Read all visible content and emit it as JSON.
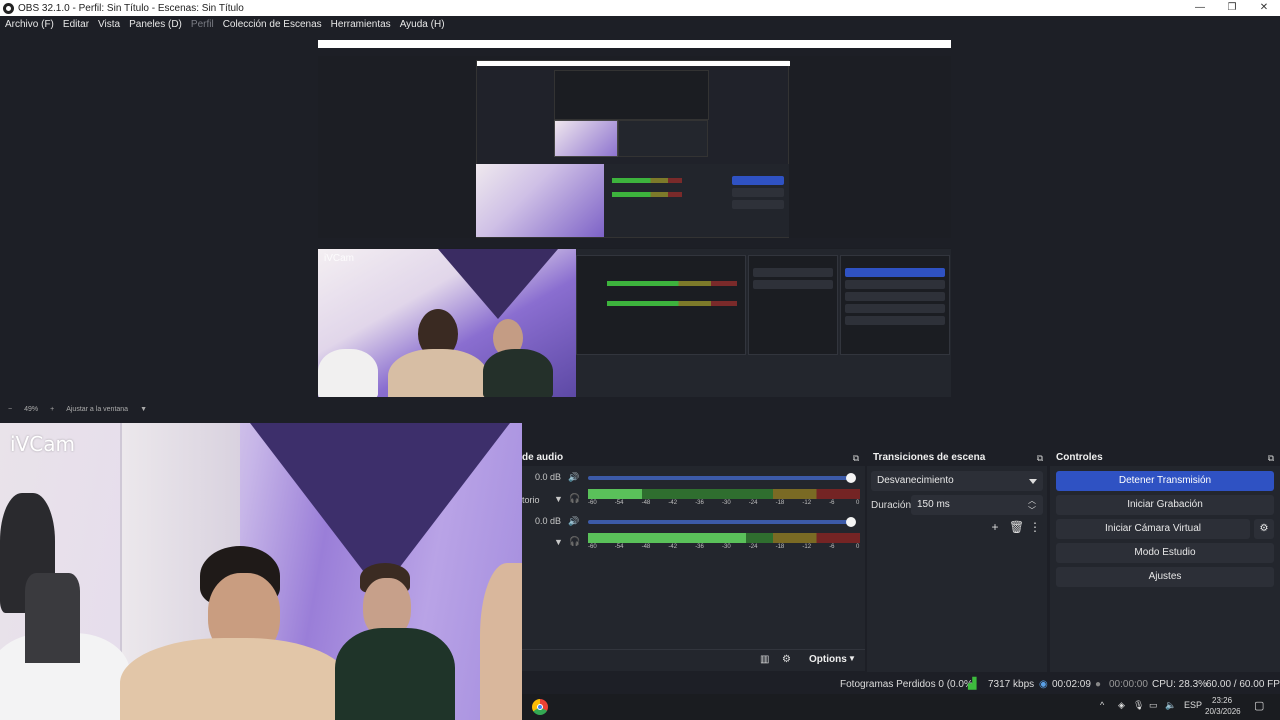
{
  "window": {
    "title": "OBS 32.1.0 - Perfil: Sin Título - Escenas: Sin Título",
    "minimize": "—",
    "maximize": "❐",
    "close": "✕"
  },
  "menu": [
    {
      "label": "Archivo (F)",
      "disabled": false
    },
    {
      "label": "Editar",
      "disabled": false
    },
    {
      "label": "Vista",
      "disabled": false
    },
    {
      "label": "Paneles (D)",
      "disabled": false
    },
    {
      "label": "Perfil",
      "disabled": true
    },
    {
      "label": "Colección de Escenas",
      "disabled": false
    },
    {
      "label": "Herramientas",
      "disabled": false
    },
    {
      "label": "Ayuda (H)",
      "disabled": false
    }
  ],
  "preview": {
    "source_label": "iVCam",
    "inner_source_label": "iVCam"
  },
  "zoombar": {
    "minus": "−",
    "zoom": "49%",
    "plus": "+",
    "fit": "Ajustar a la ventana"
  },
  "camera": {
    "label": "iVCam"
  },
  "mixer": {
    "title": "de audio",
    "tracks": [
      {
        "name": "torio",
        "db": "0.0 dB",
        "level": 0.2
      },
      {
        "name": "",
        "db": "0.0 dB",
        "level": 0.58
      }
    ],
    "scale": [
      "-60",
      "-54",
      "-48",
      "-42",
      "-36",
      "-30",
      "-24",
      "-18",
      "-12",
      "-6",
      "0"
    ],
    "footer_options": "Options"
  },
  "transitions": {
    "title": "Transiciones de escena",
    "type": "Desvanecimiento",
    "duration_label": "Duración",
    "duration_value": "150 ms"
  },
  "controls": {
    "title": "Controles",
    "buttons": [
      "Detener Transmisión",
      "Iniciar Grabación",
      "Iniciar Cámara Virtual",
      "Modo Estudio",
      "Ajustes"
    ]
  },
  "status": {
    "dropped": "Fotogramas Perdidos 0 (0.0%)",
    "bitrate": "7317 kbps",
    "stream_time": "00:02:09",
    "record_time": "00:00:00",
    "cpu": "CPU: 28.3%",
    "fps": "60.00 / 60.00 FPS"
  },
  "taskbar": {
    "lang": "ESP",
    "time": "23:26",
    "date": "20/3/2026"
  },
  "colors": {
    "accent": "#2f52c3",
    "meter_green": "#5ac15a",
    "bitrate_green": "#3dbb3d"
  }
}
